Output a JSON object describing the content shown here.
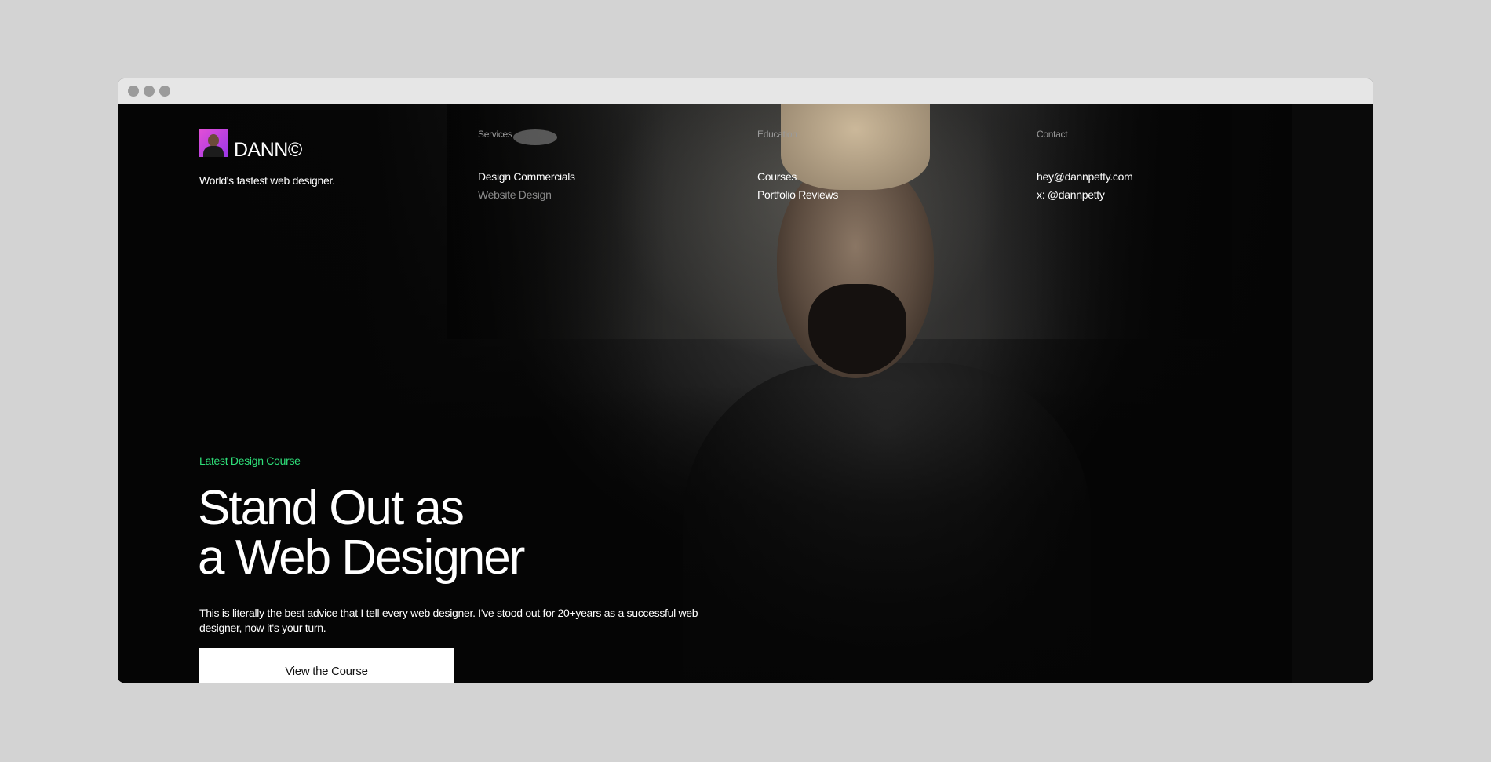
{
  "window": {
    "controls": [
      "close",
      "minimize",
      "maximize"
    ]
  },
  "brand": {
    "name": "DANN©",
    "tagline": "World's fastest web designer."
  },
  "nav": {
    "services": {
      "heading": "Services",
      "links": [
        "Design Commercials",
        "Website Design"
      ]
    },
    "education": {
      "heading": "Education",
      "links": [
        "Courses",
        "Portfolio Reviews"
      ]
    },
    "contact": {
      "heading": "Contact",
      "links": [
        "hey@dannpetty.com",
        "x: @dannpetty"
      ]
    }
  },
  "hero": {
    "eyebrow": "Latest Design Course",
    "headline_line1": "Stand Out as",
    "headline_line2": "a Web Designer",
    "lede": "This is literally the best advice that I tell every web designer. I've stood out for 20+years as a successful web designer, now it's your turn.",
    "cta_label": "View the Course"
  },
  "colors": {
    "page_background": "#d3d3d3",
    "titlebar": "#e6e6e6",
    "hero_background": "#050505",
    "accent_green": "#2fe07a",
    "cta_background": "#ffffff"
  }
}
